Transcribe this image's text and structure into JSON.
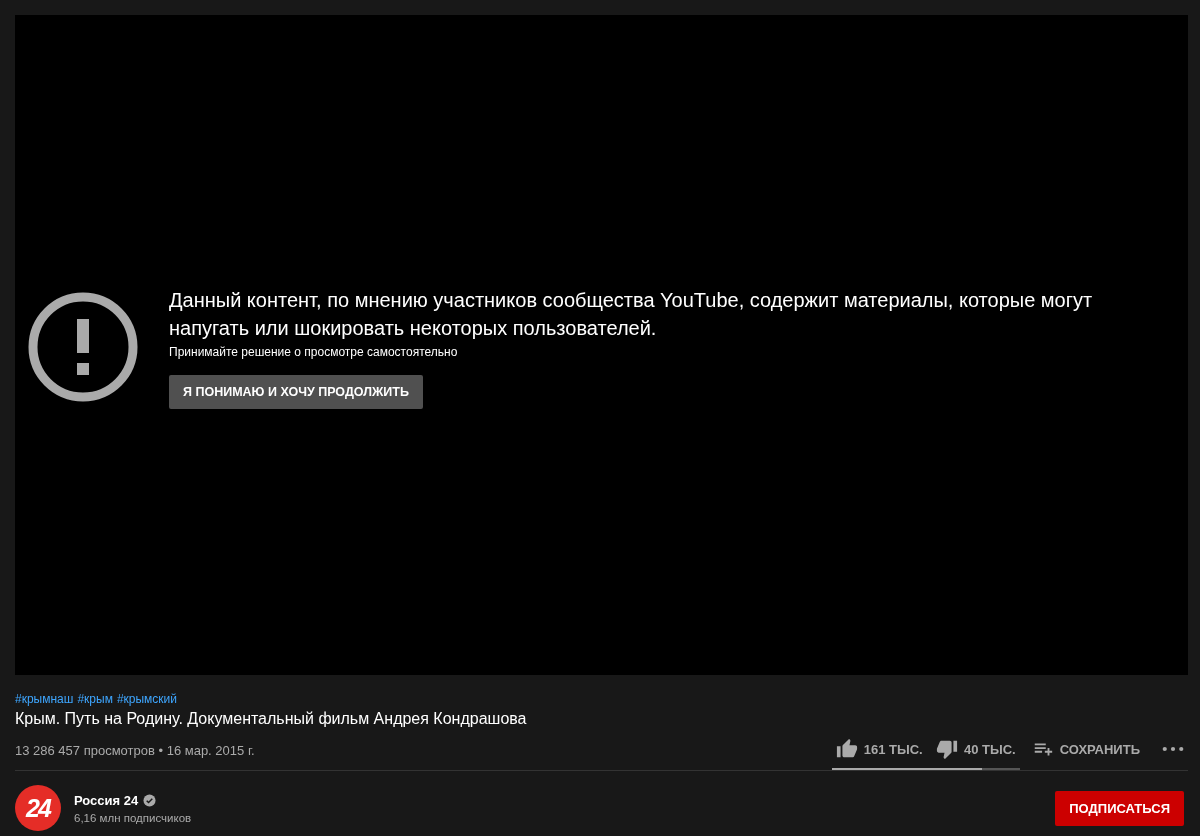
{
  "player": {
    "warning": {
      "message": "Данный контент, по мнению участников сообщества YouTube, содержит материалы, которые могут напугать или шокировать некоторых пользователей.",
      "hint": "Принимайте решение о просмотре самостоятельно",
      "button": "Я ПОНИМАЮ И ХОЧУ ПРОДОЛЖИТЬ"
    }
  },
  "video": {
    "hashtags": [
      "#крымнаш",
      "#крым",
      "#крымский"
    ],
    "title": "Крым. Путь на Родину. Документальный фильм Андрея Кондрашова",
    "meta": "13 286 457 просмотров • 16 мар. 2015 г.",
    "likes": "161 ТЫС.",
    "dislikes": "40 ТЫС.",
    "sentiment": {
      "level": 0.8
    },
    "save": "СОХРАНИТЬ"
  },
  "channel": {
    "logo": "24",
    "name": "Россия 24",
    "verified": true,
    "subscribers": "6,16 млн подписчиков",
    "subscribe": "ПОДПИСАТЬСЯ"
  }
}
